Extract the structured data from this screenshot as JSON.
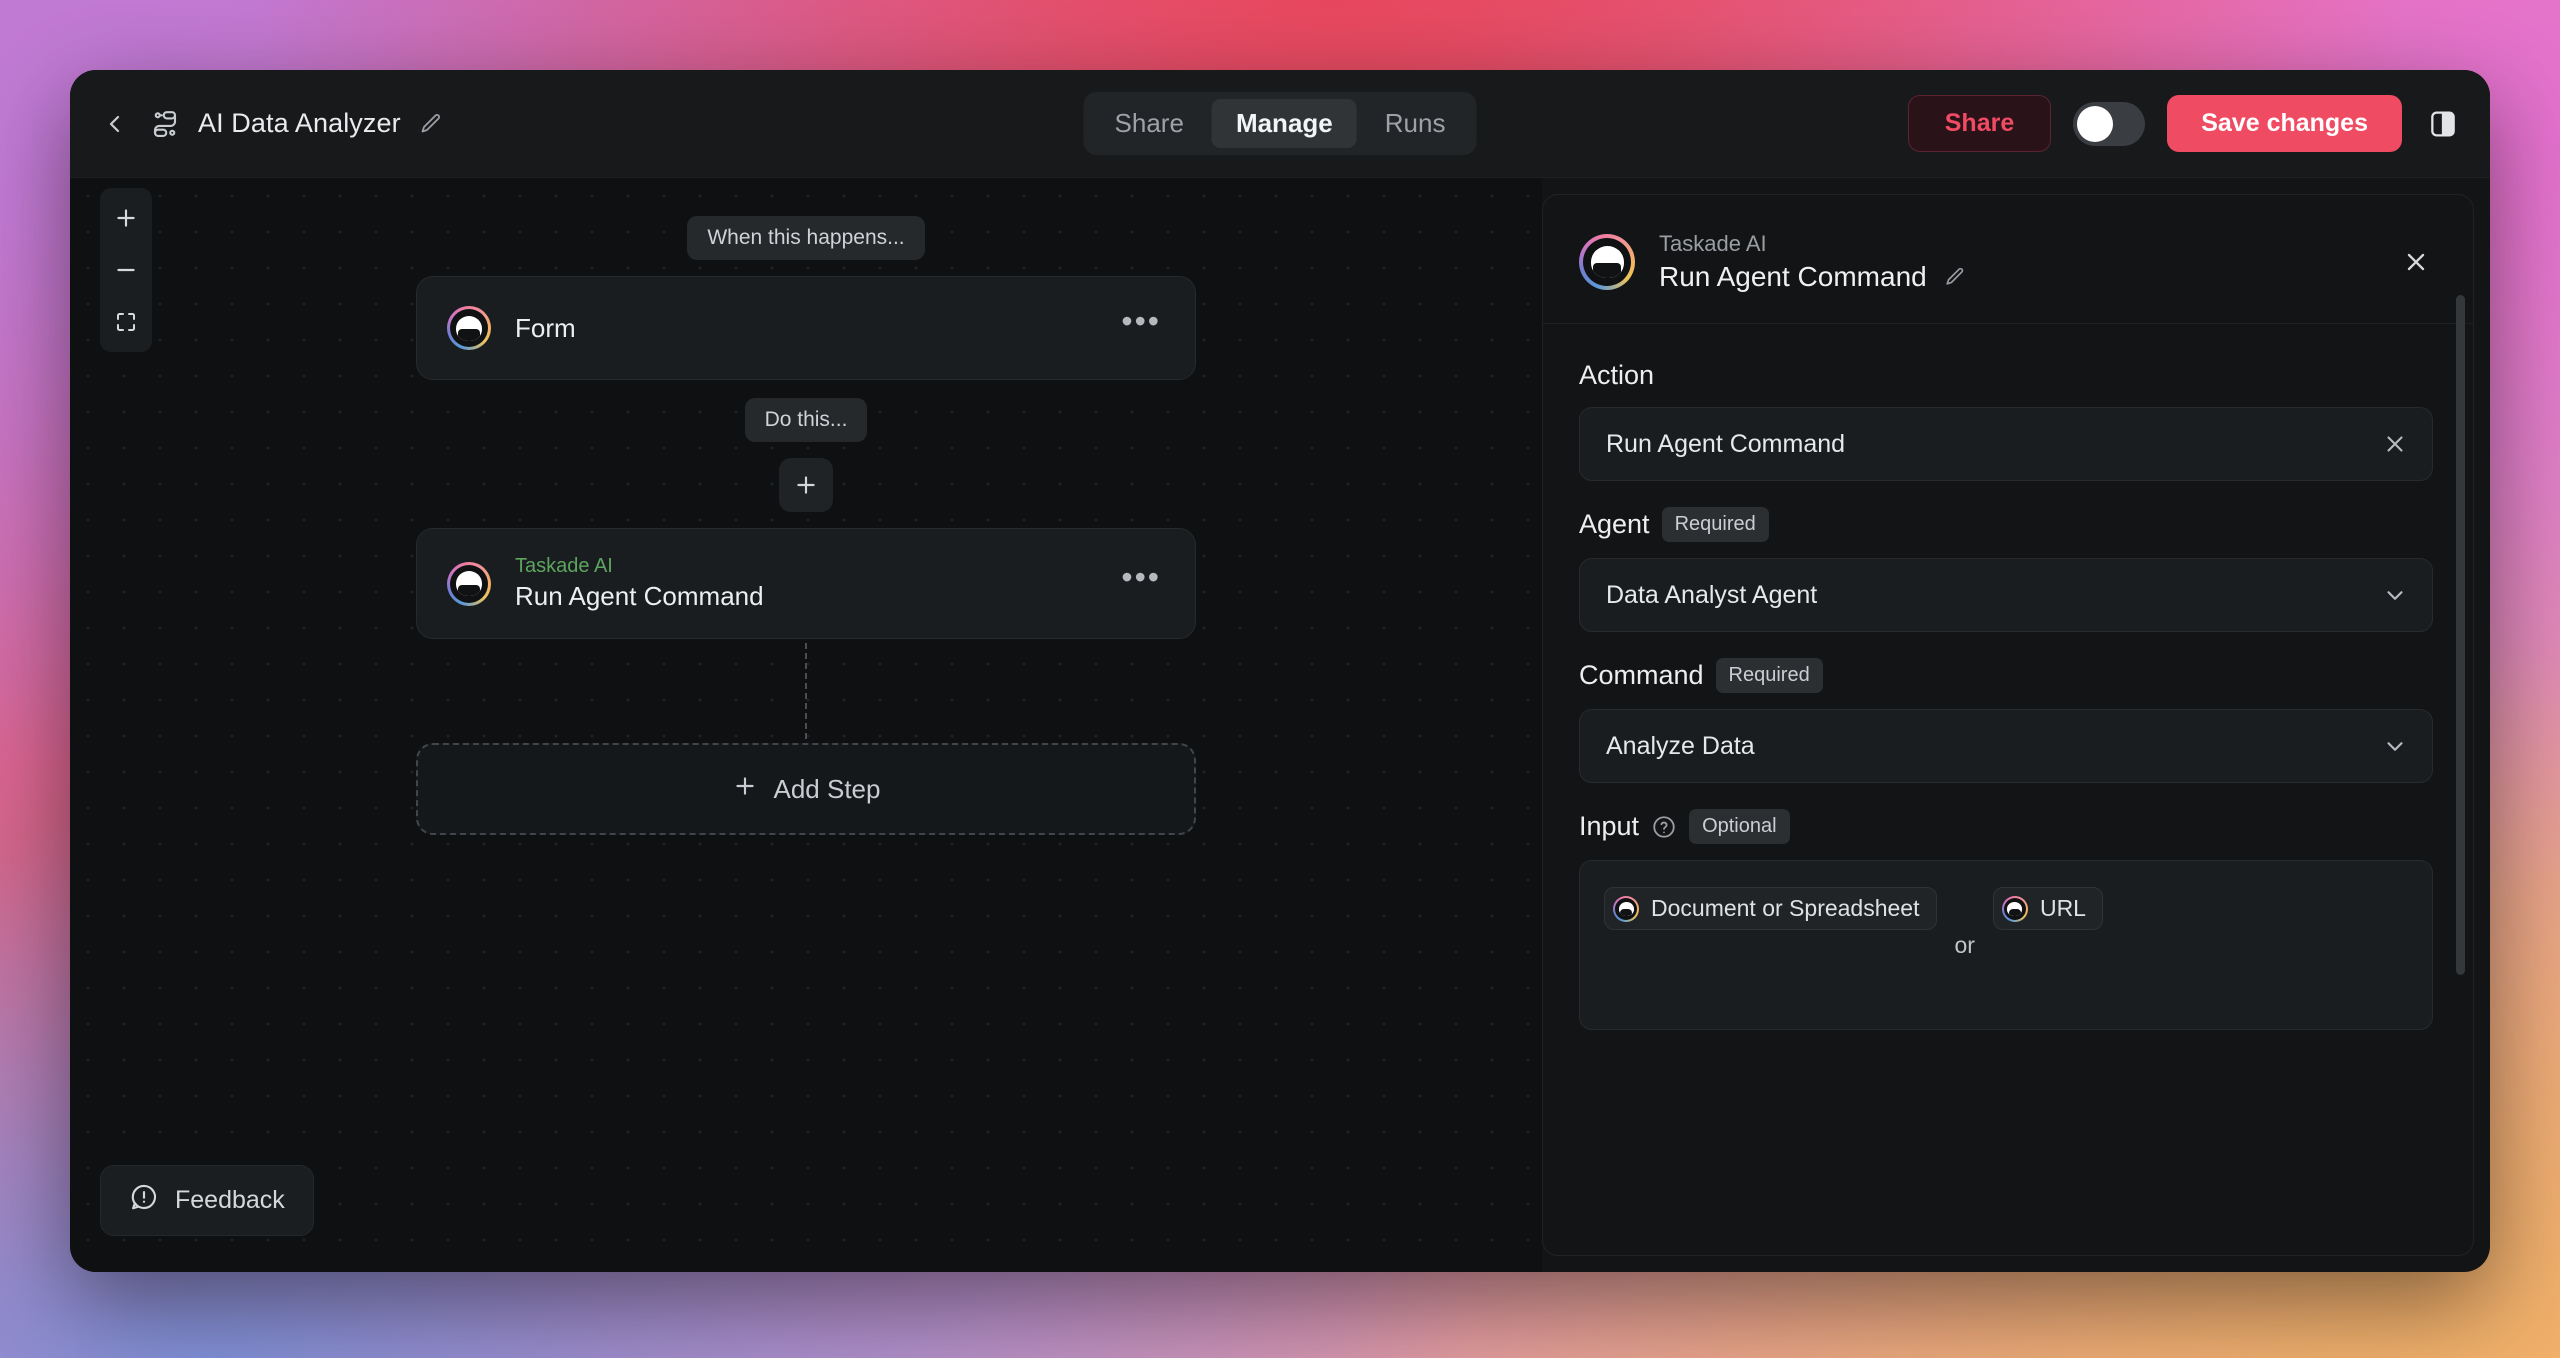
{
  "window": {
    "topbar": {
      "back_icon": "chevron-left-icon",
      "flow_icon": "workflow-icon",
      "title": "AI Data Analyzer",
      "edit_icon": "pencil-icon",
      "tabs": [
        {
          "label": "Share",
          "active": false
        },
        {
          "label": "Manage",
          "active": true
        },
        {
          "label": "Runs",
          "active": false
        }
      ],
      "share_button": "Share",
      "toggle_state": "off",
      "save_button": "Save changes",
      "panel_toggle_icon": "sidebar-panel-icon"
    },
    "canvas": {
      "zoom_controls": {
        "zoom_in_icon": "plus-icon",
        "zoom_out_icon": "minus-icon",
        "fit_view_icon": "fit-screen-icon"
      },
      "trigger_label": "When this happens...",
      "trigger_node": {
        "title": "Form",
        "menu_icon": "more-horizontal-icon",
        "avatar_icon": "taskade-mascot-icon"
      },
      "action_label": "Do this...",
      "add_inline_icon": "plus-icon",
      "action_node": {
        "subtitle": "Taskade AI",
        "title": "Run Agent Command",
        "menu_icon": "more-horizontal-icon",
        "avatar_icon": "taskade-mascot-icon"
      },
      "add_step_label": "Add Step",
      "add_step_icon": "plus-icon",
      "feedback_label": "Feedback",
      "feedback_icon": "feedback-bubble-icon"
    },
    "side_panel": {
      "header": {
        "avatar_icon": "taskade-mascot-icon",
        "subtitle": "Taskade AI",
        "title": "Run Agent Command",
        "edit_icon": "pencil-icon",
        "close_icon": "close-icon"
      },
      "fields": {
        "action": {
          "label": "Action",
          "value": "Run Agent Command",
          "clear_icon": "close-icon"
        },
        "agent": {
          "label": "Agent",
          "badge": "Required",
          "value": "Data Analyst Agent",
          "chevron_icon": "chevron-down-icon"
        },
        "command": {
          "label": "Command",
          "badge": "Required",
          "value": "Analyze Data",
          "chevron_icon": "chevron-down-icon"
        },
        "input": {
          "label": "Input",
          "help_icon": "question-circle-icon",
          "badge": "Optional",
          "token_document": "Document or Spreadsheet",
          "separator": "or",
          "token_url": "URL"
        }
      }
    }
  },
  "colors": {
    "accent": "#ef4b63",
    "window_bg": "#121415",
    "canvas_bg": "#0e1011",
    "node_bg": "#1a1d1f",
    "green_label": "#5da55f"
  }
}
